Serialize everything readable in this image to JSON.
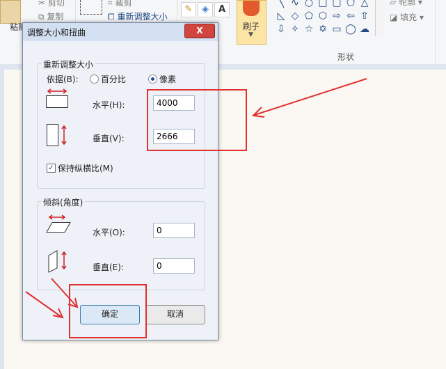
{
  "ribbon": {
    "paste_label": "粘贴",
    "cut_label": "剪切",
    "copy_label": "复制",
    "crop_label": "裁剪",
    "resize_label": "重新调整大小",
    "brush_label": "刷子",
    "shapes_group_label": "形状",
    "outline_label": "轮廓",
    "fill_label": "填充",
    "shape_icons": [
      "line-icon",
      "curve-icon",
      "oval-icon",
      "rectangle-icon",
      "rounded-rect-icon",
      "polygon-icon",
      "triangle-icon",
      "right-triangle-icon",
      "diamond-icon",
      "pentagon-icon",
      "hexagon-icon",
      "right-arrow-icon",
      "left-arrow-icon",
      "up-arrow-icon",
      "down-arrow-icon",
      "four-point-star-icon",
      "five-point-star-icon",
      "six-point-star-icon",
      "callout-rect-icon",
      "callout-oval-icon",
      "cloud-icon"
    ]
  },
  "dialog": {
    "title": "调整大小和扭曲",
    "close_label": "X",
    "resize": {
      "group_label": "重新调整大小",
      "by_label": "依据(B):",
      "percent_label": "百分比",
      "pixels_label": "像素",
      "selected": "pixels",
      "horizontal_label": "水平(H):",
      "horizontal_value": "4000",
      "vertical_label": "垂直(V):",
      "vertical_value": "2666",
      "keep_ratio_label": "保持纵横比(M)",
      "keep_ratio_checked": true
    },
    "skew": {
      "group_label": "倾斜(角度)",
      "horizontal_label": "水平(O):",
      "horizontal_value": "0",
      "vertical_label": "垂直(E):",
      "vertical_value": "0"
    },
    "ok_label": "确定",
    "cancel_label": "取消"
  },
  "colors": {
    "accent_red": "#e03030",
    "dialog_bg": "#eef2f8",
    "title_bg": "#d3e0f1"
  }
}
